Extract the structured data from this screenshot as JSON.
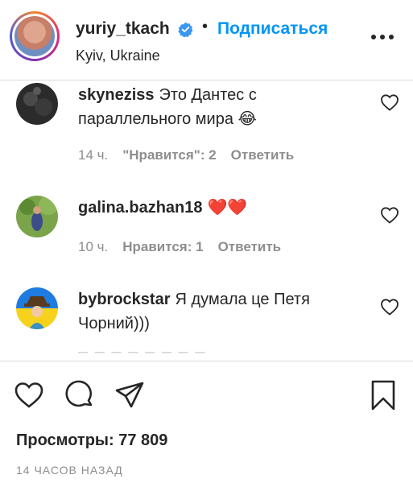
{
  "header": {
    "username": "yuriy_tkach",
    "dot": "•",
    "follow_label": "Подписаться",
    "location": "Kyiv, Ukraine"
  },
  "comments": [
    {
      "user": "skyneziss",
      "text": "Это Дантес с параллельного мира 😂",
      "time": "14 ч.",
      "likes": "\"Нравится\": 2",
      "reply": "Ответить"
    },
    {
      "user": "galina.bazhan18",
      "text": "❤️❤️",
      "time": "10 ч.",
      "likes": "Нравится: 1",
      "reply": "Ответить"
    },
    {
      "user": "bybrockstar",
      "text": "Я думала це Петя Чорний)))",
      "time": "",
      "likes": "",
      "reply": ""
    }
  ],
  "footer": {
    "views": "Просмотры: 77 809",
    "timestamp": "14 ЧАСОВ НАЗАД"
  },
  "colors": {
    "accent": "#0095f6",
    "text": "#262626",
    "muted": "#8e8e8e",
    "divider": "#dbdbdb"
  },
  "icons": [
    "verified-badge-icon",
    "more-options-icon",
    "heart-icon",
    "comment-icon",
    "share-icon",
    "bookmark-icon"
  ]
}
